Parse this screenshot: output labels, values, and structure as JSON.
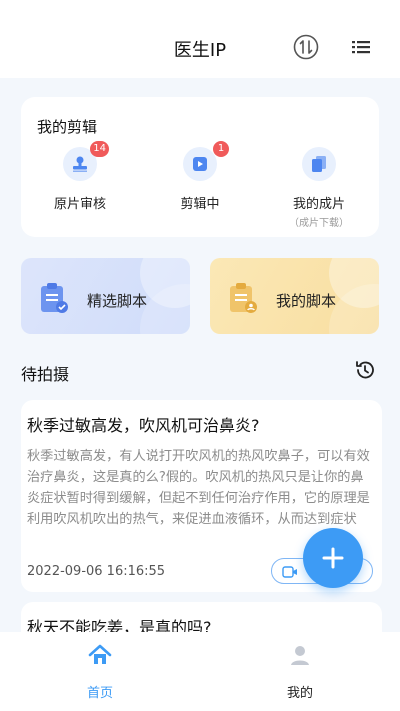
{
  "header": {
    "title": "医生IP"
  },
  "editing": {
    "title": "我的剪辑",
    "items": [
      {
        "label": "原片审核",
        "badge": "14",
        "sub": ""
      },
      {
        "label": "剪辑中",
        "badge": "1",
        "sub": ""
      },
      {
        "label": "我的成片",
        "badge": "",
        "sub": "（成片下载）"
      }
    ]
  },
  "scripts": {
    "selected": "精选脚本",
    "mine": "我的脚本"
  },
  "pending": {
    "title": "待拍摄"
  },
  "posts": [
    {
      "title": "秋季过敏高发，吹风机可治鼻炎?",
      "body": "秋季过敏高发，有人说打开吹风机的热风吹鼻子，可以有效治疗鼻炎，这是真的么?假的。吹风机的热风只是让你的鼻炎症状暂时得到缓解，但起不到任何治疗作用，它的原理是利用吹风机吹出的热气，来促进血液循环，从而达到症状",
      "date": "2022-09-06 16:16:55"
    },
    {
      "title": "秋天不能吃姜，是真的吗?"
    }
  ],
  "tabbar": {
    "home": "首页",
    "mine": "我的"
  },
  "colors": {
    "accent": "#3d9bf5",
    "badge": "#f05a5a",
    "blue_card": "#dfe7fb",
    "yellow_card": "#fbe7b2"
  }
}
